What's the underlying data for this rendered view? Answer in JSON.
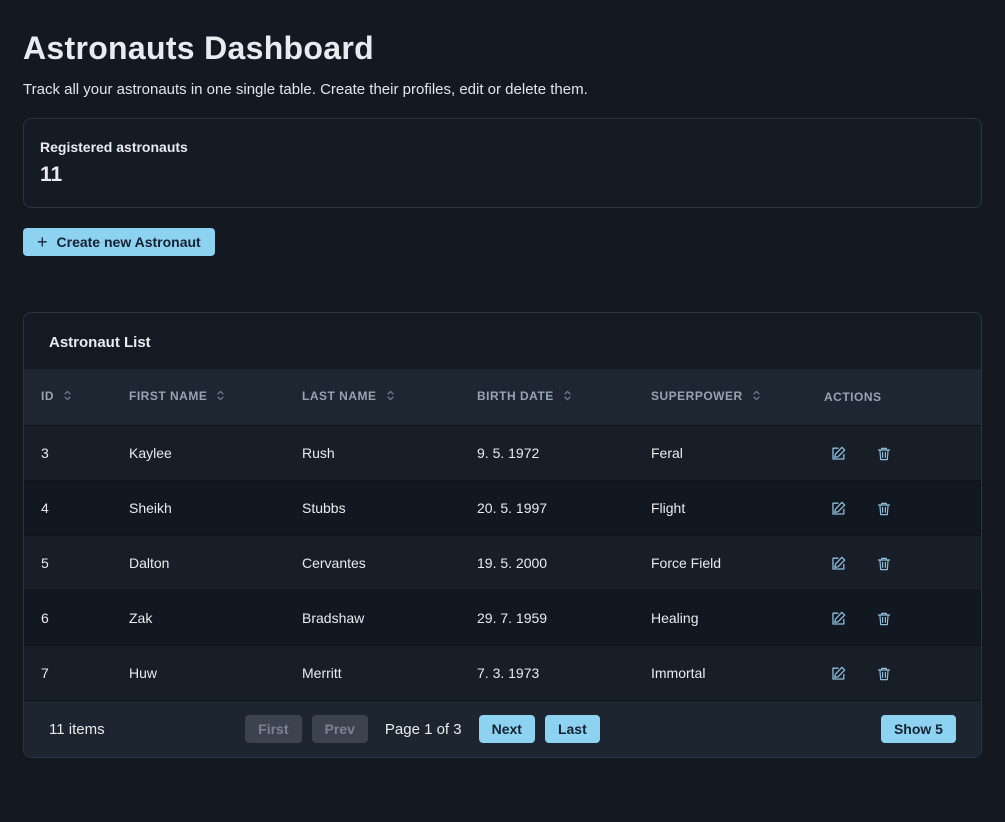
{
  "page": {
    "title": "Astronauts Dashboard",
    "subtitle": "Track all your astronauts in one single table. Create their profiles, edit or delete them."
  },
  "stats": {
    "label": "Registered astronauts",
    "value": "11"
  },
  "create_button": {
    "icon": "+",
    "label": "Create new Astronaut"
  },
  "table": {
    "title": "Astronaut List",
    "columns": [
      {
        "key": "id",
        "label": "ID",
        "sortable": true
      },
      {
        "key": "first_name",
        "label": "FIRST NAME",
        "sortable": true
      },
      {
        "key": "last_name",
        "label": "LAST NAME",
        "sortable": true
      },
      {
        "key": "birth_date",
        "label": "BIRTH DATE",
        "sortable": true
      },
      {
        "key": "superpower",
        "label": "SUPERPOWER",
        "sortable": true
      },
      {
        "key": "actions",
        "label": "ACTIONS",
        "sortable": false
      }
    ],
    "rows": [
      {
        "id": "3",
        "first_name": "Kaylee",
        "last_name": "Rush",
        "birth_date": "9. 5. 1972",
        "superpower": "Feral"
      },
      {
        "id": "4",
        "first_name": "Sheikh",
        "last_name": "Stubbs",
        "birth_date": "20. 5. 1997",
        "superpower": "Flight"
      },
      {
        "id": "5",
        "first_name": "Dalton",
        "last_name": "Cervantes",
        "birth_date": "19. 5. 2000",
        "superpower": "Force Field"
      },
      {
        "id": "6",
        "first_name": "Zak",
        "last_name": "Bradshaw",
        "birth_date": "29. 7. 1959",
        "superpower": "Healing"
      },
      {
        "id": "7",
        "first_name": "Huw",
        "last_name": "Merritt",
        "birth_date": "7. 3. 1973",
        "superpower": "Immortal"
      }
    ],
    "footer": {
      "items_label": "11 items",
      "page_label": "Page 1 of 3",
      "buttons": {
        "first": "First",
        "prev": "Prev",
        "next": "Next",
        "last": "Last",
        "show": "Show 5"
      }
    }
  },
  "colors": {
    "accent": "#8ed2f2",
    "background": "#131821"
  }
}
